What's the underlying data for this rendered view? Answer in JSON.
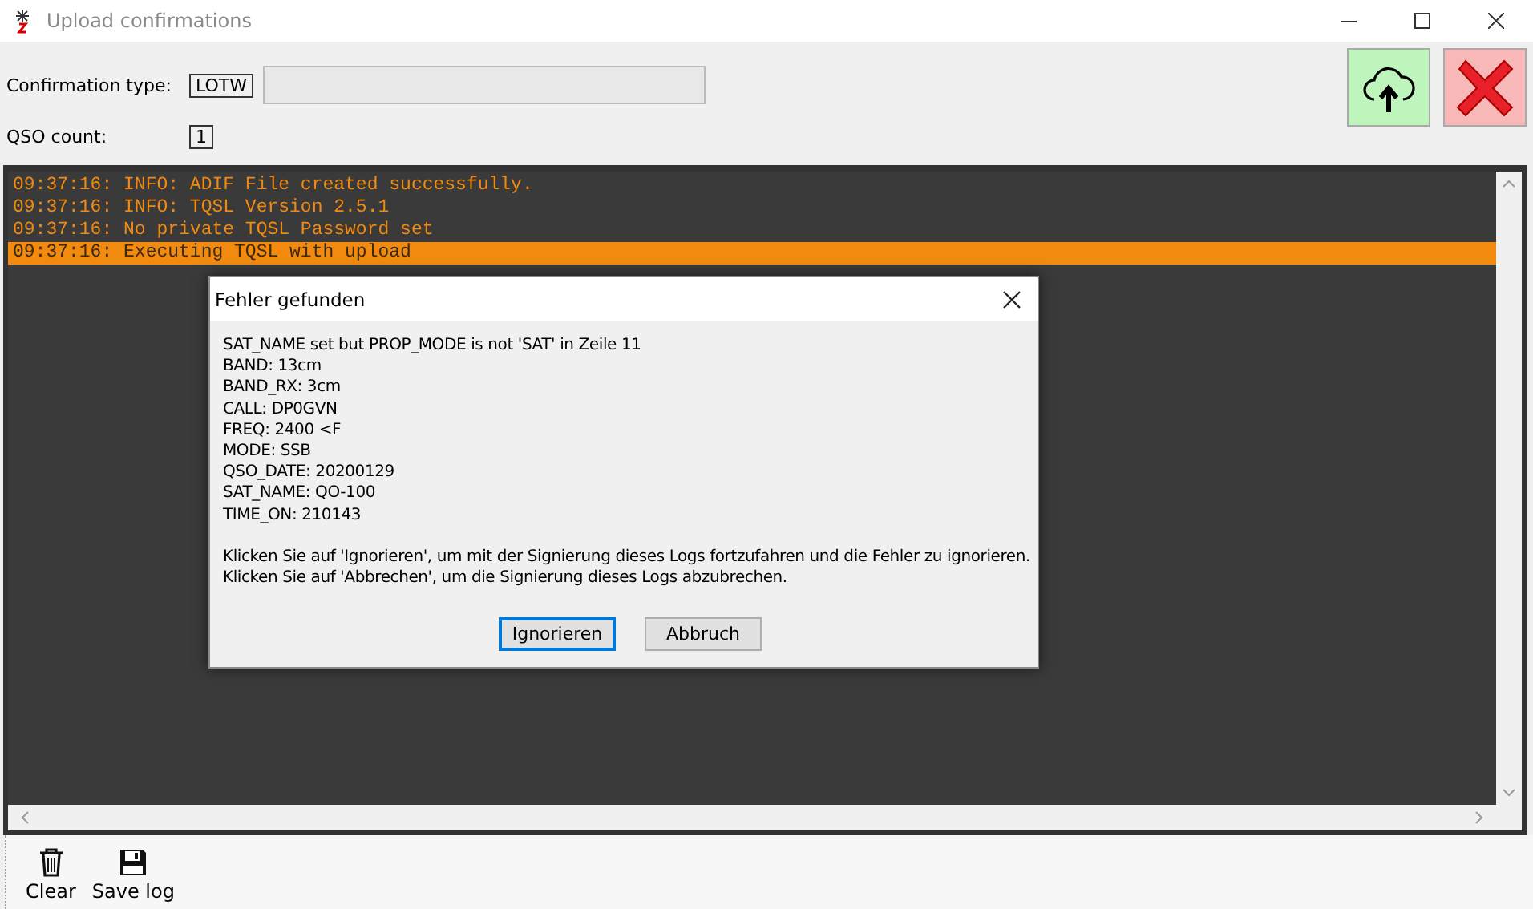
{
  "window": {
    "title": "Upload confirmations"
  },
  "confirmation_type": {
    "label": "Confirmation type:",
    "value": "LOTW"
  },
  "qso_count": {
    "label": "QSO count:",
    "value": "1"
  },
  "log": [
    {
      "text": "09:37:16: INFO: ADIF File created successfully.",
      "selected": false
    },
    {
      "text": "09:37:16: INFO: TQSL Version 2.5.1",
      "selected": false
    },
    {
      "text": "09:37:16: No private TQSL Password set",
      "selected": false
    },
    {
      "text": "09:37:16: Executing TQSL with upload",
      "selected": true
    }
  ],
  "dialog": {
    "title": "Fehler gefunden",
    "details": [
      "SAT_NAME set but PROP_MODE is not 'SAT' in Zeile 11",
      "BAND: 13cm",
      "BAND_RX: 3cm",
      "CALL: DP0GVN",
      "FREQ: 2400 <F",
      "MODE: SSB",
      "QSO_DATE: 20200129",
      "SAT_NAME: QO-100",
      "TIME_ON: 210143"
    ],
    "instructions": [
      "Klicken Sie auf 'Ignorieren', um mit der Signierung dieses Logs fortzufahren und die Fehler zu ignorieren.",
      "Klicken Sie auf 'Abbrechen', um die Signierung dieses Logs abzubrechen."
    ],
    "buttons": [
      {
        "label": "Ignorieren",
        "selected": true
      },
      {
        "label": "Abbruch",
        "selected": false
      }
    ]
  },
  "toolbar": [
    {
      "kind": "trash",
      "label": "Clear"
    },
    {
      "kind": "save",
      "label": "Save log"
    }
  ]
}
